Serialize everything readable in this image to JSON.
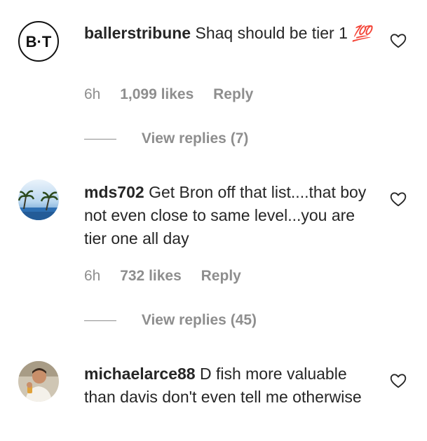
{
  "comments": [
    {
      "username": "ballerstribune",
      "text": "Shaq should be tier 1",
      "emoji": "💯",
      "avatar_text": "B·T",
      "time": "6h",
      "likes": "1,099 likes",
      "reply": "Reply",
      "view_replies": "View replies (7)",
      "avatar_icon": "ballerstribune-logo"
    },
    {
      "username": "mds702",
      "text": "Get Bron off that list....that boy not even close to same level...you are tier one all day",
      "time": "6h",
      "likes": "732 likes",
      "reply": "Reply",
      "view_replies": "View replies (45)",
      "avatar_icon": "beach-photo-avatar"
    },
    {
      "username": "michaelarce88",
      "text": "D fish more valuable than davis don't even tell me otherwise",
      "avatar_icon": "person-photo-avatar"
    }
  ],
  "icons": {
    "like": "heart-outline-icon"
  },
  "colors": {
    "text": "#262626",
    "muted": "#8e8e8e",
    "emoji": "#e0245e"
  }
}
